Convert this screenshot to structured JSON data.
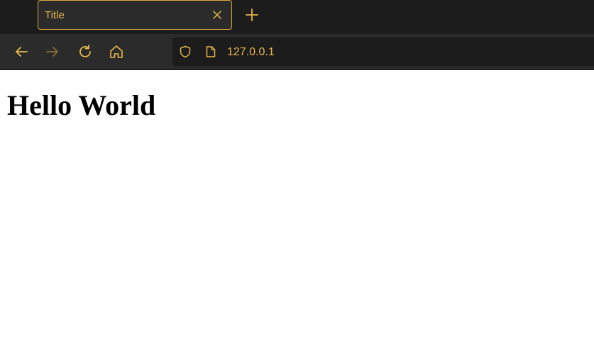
{
  "browser": {
    "tab": {
      "title": "Title",
      "close_icon": "close-icon"
    },
    "new_tab_icon": "plus-icon",
    "nav": {
      "back_icon": "arrow-left-icon",
      "forward_icon": "arrow-right-icon",
      "reload_icon": "reload-icon",
      "home_icon": "home-icon"
    },
    "address_bar": {
      "shield_icon": "shield-icon",
      "page_icon": "page-icon",
      "url": "127.0.0.1"
    },
    "colors": {
      "accent": "#e8b84a",
      "chrome_dark": "#1c1c1c",
      "chrome_toolbar": "#2b2b2b",
      "forward_disabled": "#8a6a3a"
    }
  },
  "page": {
    "heading": "Hello World"
  }
}
